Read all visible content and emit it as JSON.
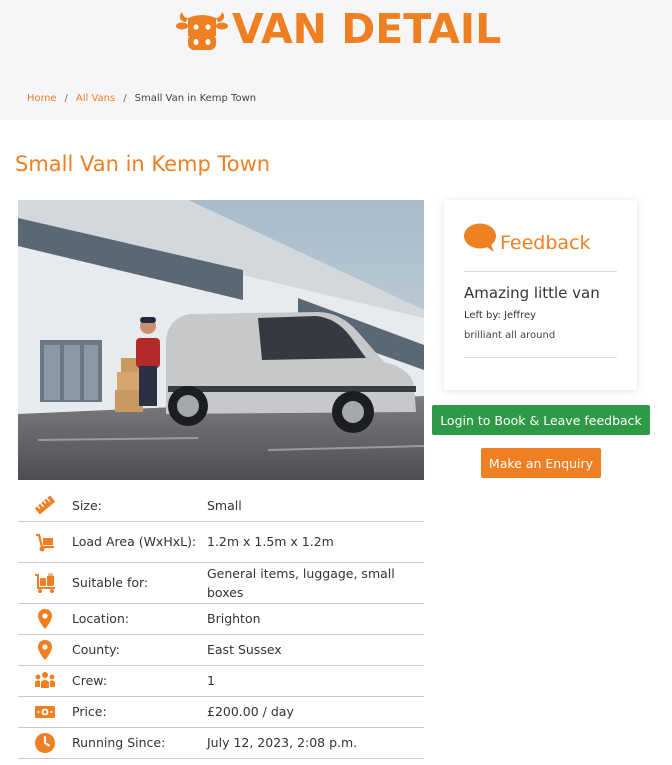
{
  "header": {
    "logo_icon": "cow-face-icon",
    "title": "VAN DETAIL"
  },
  "breadcrumb": {
    "home": "Home",
    "all_vans": "All Vans",
    "separator": "/",
    "current": "Small Van in Kemp Town"
  },
  "listing": {
    "title": "Small Van in Kemp Town"
  },
  "specs": [
    {
      "icon": "ruler-icon",
      "label": "Size:",
      "value": "Small"
    },
    {
      "icon": "hand-truck-icon",
      "label": "Load Area (WxHxL):",
      "value": "1.2m x 1.5m x 1.2m"
    },
    {
      "icon": "luggage-cart-icon",
      "label": "Suitable for:",
      "value": "General items, luggage, small boxes"
    },
    {
      "icon": "map-pin-icon",
      "label": "Location:",
      "value": "Brighton"
    },
    {
      "icon": "map-pin-icon",
      "label": "County:",
      "value": "East Sussex"
    },
    {
      "icon": "people-group-icon",
      "label": "Crew:",
      "value": "1"
    },
    {
      "icon": "money-bill-icon",
      "label": "Price:",
      "value": "£200.00 / day"
    },
    {
      "icon": "clock-icon",
      "label": "Running Since:",
      "value": "July 12, 2023, 2:08 p.m."
    }
  ],
  "feedback": {
    "icon": "speech-bubble-icon",
    "heading": "Feedback",
    "review_title": "Amazing little van",
    "author": "Left by: Jeffrey",
    "body": "brilliant all around"
  },
  "actions": {
    "login_label": "Login to Book & Leave feedback",
    "enquiry_label": "Make an Enquiry"
  },
  "colors": {
    "accent": "#ee7f22",
    "success": "#2f9a45",
    "hero_bg": "#f6f6f8"
  }
}
